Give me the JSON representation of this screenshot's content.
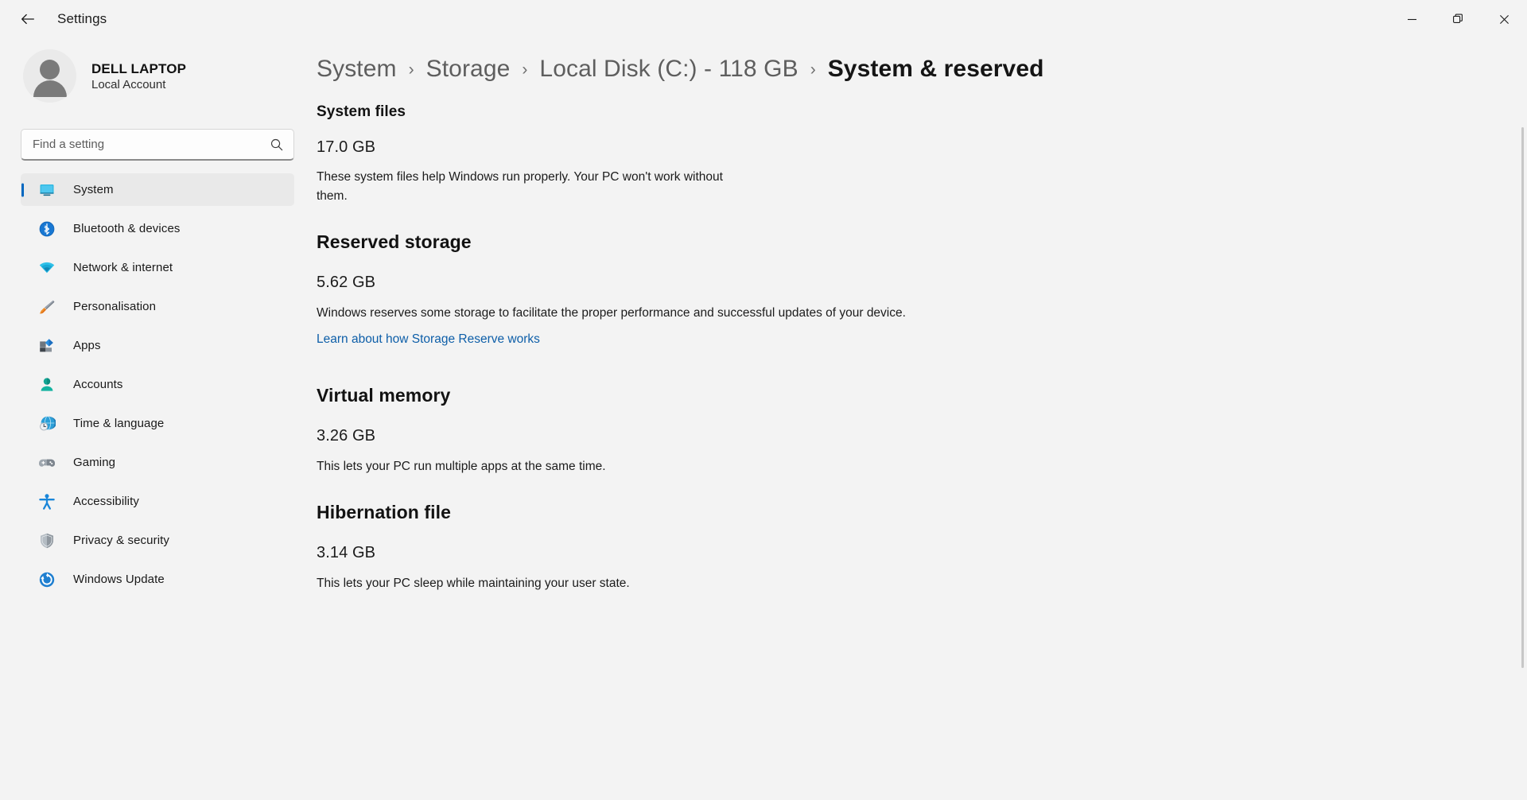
{
  "window": {
    "back_label": "back-arrow",
    "title": "Settings",
    "controls": {
      "minimize": "minimize",
      "maximize": "restore",
      "close": "close"
    }
  },
  "account": {
    "name": "DELL LAPTOP",
    "type": "Local Account",
    "avatar": "user-avatar"
  },
  "search": {
    "placeholder": "Find a setting",
    "value": "",
    "icon": "search-icon"
  },
  "sidebar": {
    "items": [
      {
        "label": "System",
        "icon": "monitor-icon",
        "selected": true
      },
      {
        "label": "Bluetooth & devices",
        "icon": "bluetooth-icon",
        "selected": false
      },
      {
        "label": "Network & internet",
        "icon": "wifi-icon",
        "selected": false
      },
      {
        "label": "Personalisation",
        "icon": "paintbrush-icon",
        "selected": false
      },
      {
        "label": "Apps",
        "icon": "apps-icon",
        "selected": false
      },
      {
        "label": "Accounts",
        "icon": "person-icon",
        "selected": false
      },
      {
        "label": "Time & language",
        "icon": "globe-clock-icon",
        "selected": false
      },
      {
        "label": "Gaming",
        "icon": "gamepad-icon",
        "selected": false
      },
      {
        "label": "Accessibility",
        "icon": "accessibility-icon",
        "selected": false
      },
      {
        "label": "Privacy & security",
        "icon": "shield-icon",
        "selected": false
      },
      {
        "label": "Windows Update",
        "icon": "update-icon",
        "selected": false
      }
    ]
  },
  "breadcrumb": {
    "separator": "›",
    "items": [
      {
        "label": "System",
        "current": false
      },
      {
        "label": "Storage",
        "current": false
      },
      {
        "label": "Local Disk (C:) - 118 GB",
        "current": false
      },
      {
        "label": "System & reserved",
        "current": true
      }
    ]
  },
  "sections": {
    "system_files": {
      "heading": "System files",
      "size": "17.0 GB",
      "description": "These system files help Windows run properly. Your PC won't work without them."
    },
    "reserved_storage": {
      "heading": "Reserved storage",
      "size": "5.62 GB",
      "description": "Windows reserves some storage to facilitate the proper performance and successful updates of your device.",
      "link": "Learn about how Storage Reserve works"
    },
    "virtual_memory": {
      "heading": "Virtual memory",
      "size": "3.26 GB",
      "description": "This lets your PC run multiple apps at the same time."
    },
    "hibernation_file": {
      "heading": "Hibernation file",
      "size": "3.14 GB",
      "description": "This lets your PC sleep while maintaining your user state."
    }
  },
  "colors": {
    "accent": "#0067c0",
    "link": "#0d5ea8",
    "page_bg": "#f3f3f3",
    "selected_bg": "#e9e9e9"
  }
}
